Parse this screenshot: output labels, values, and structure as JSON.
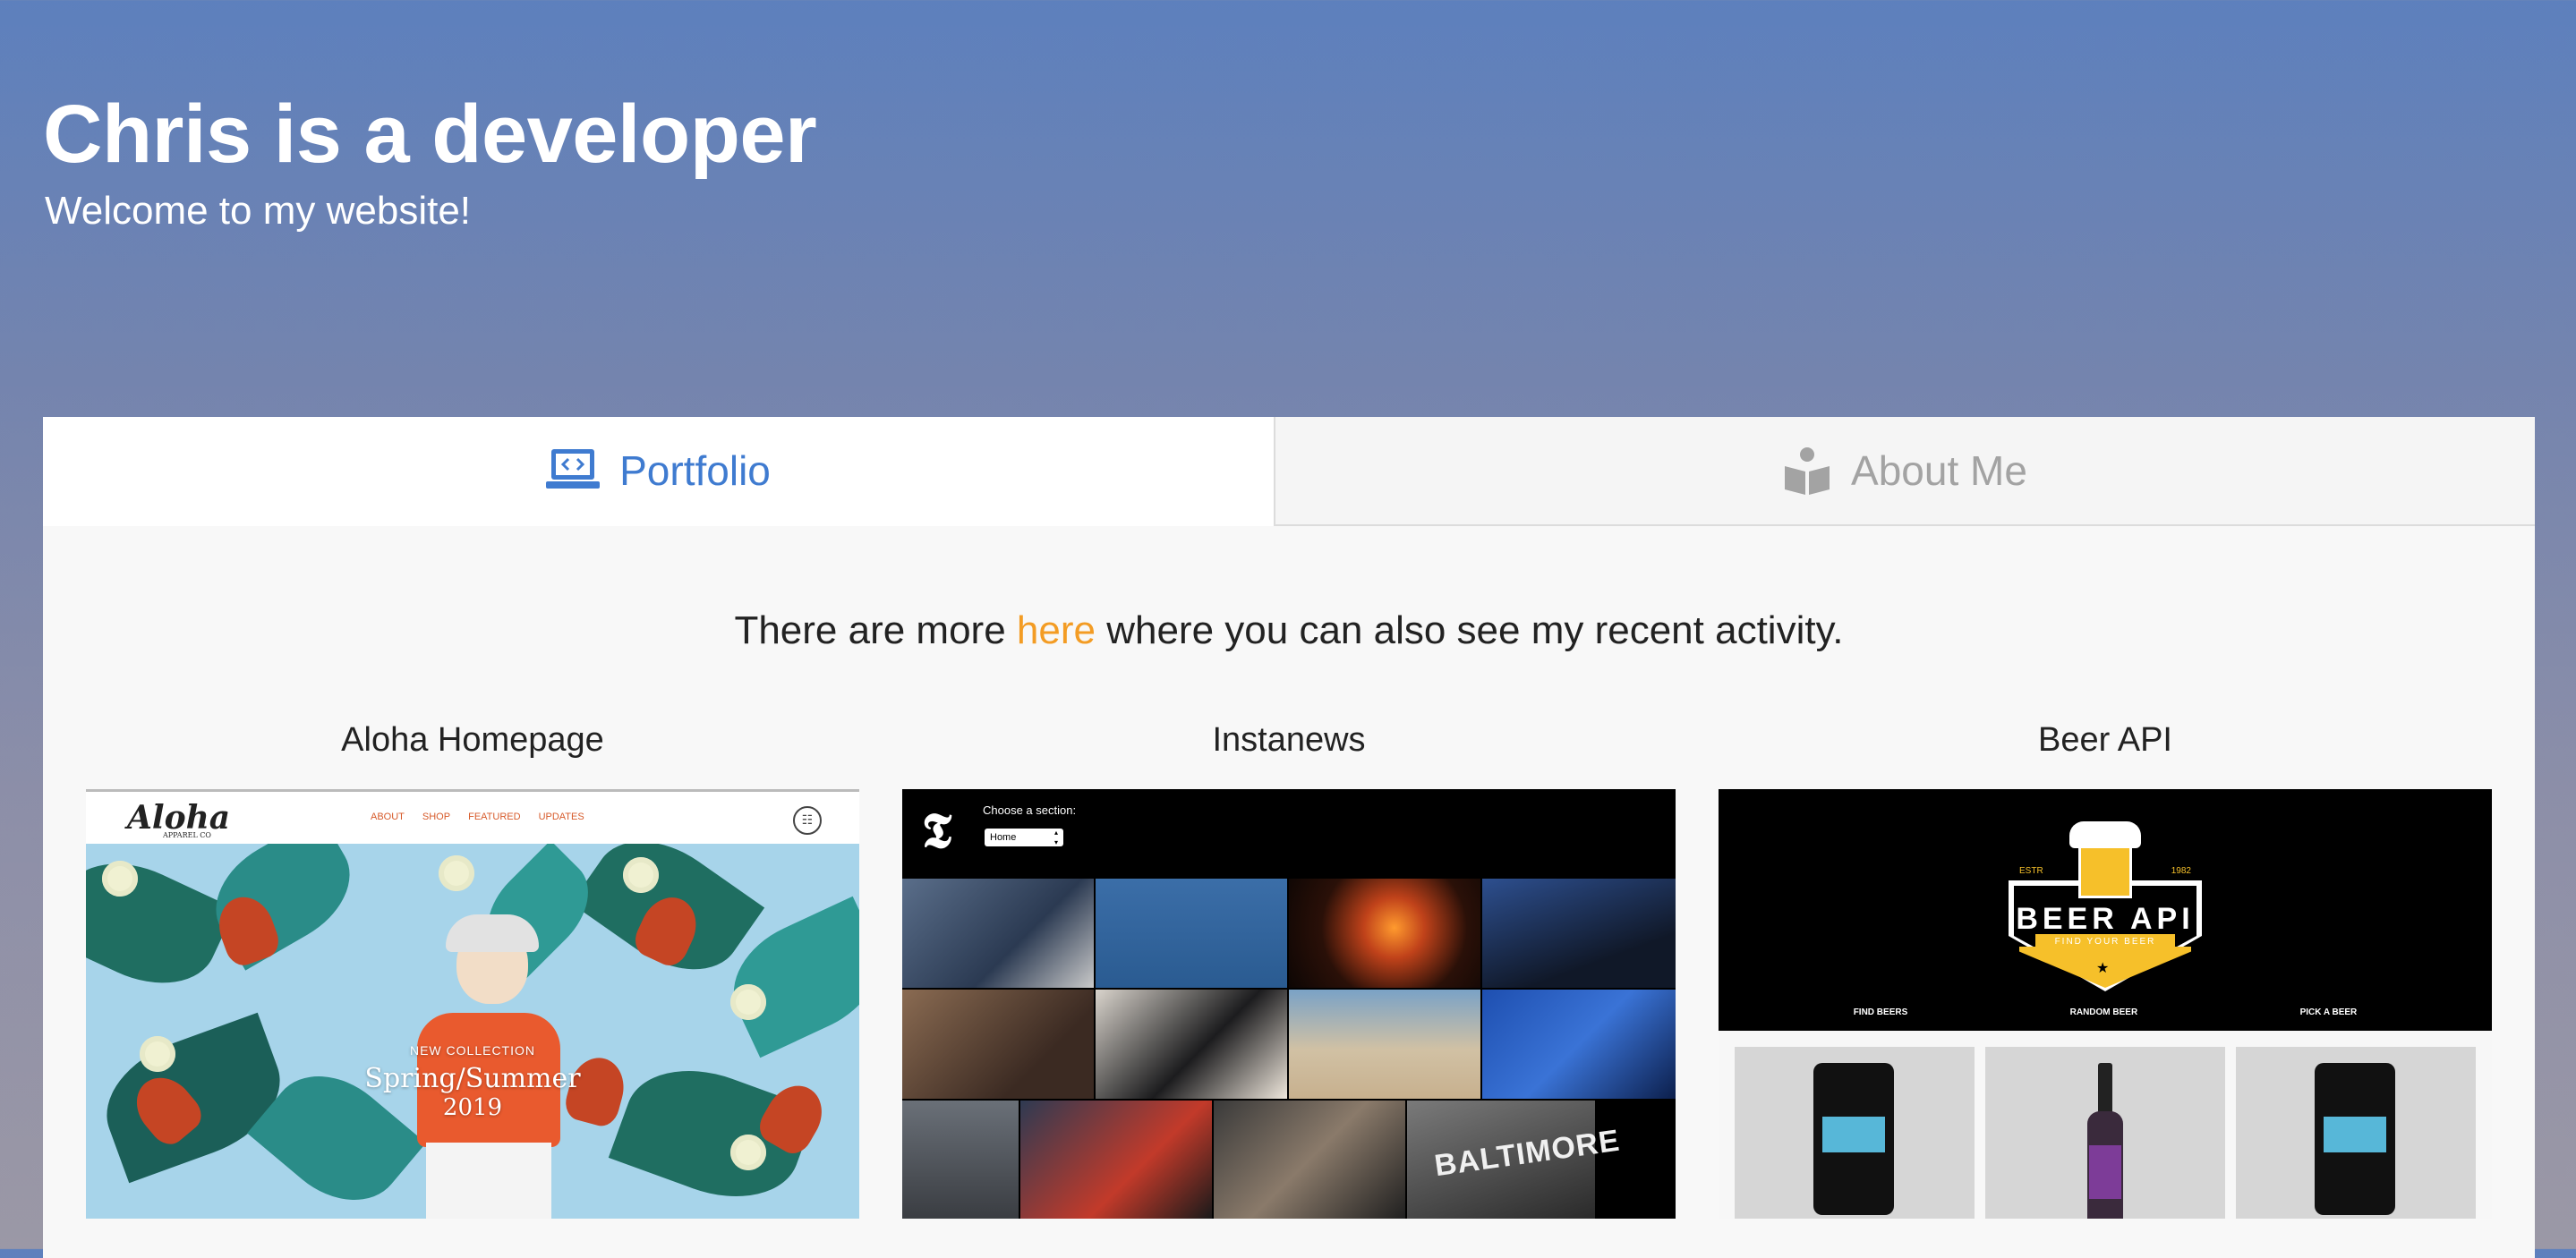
{
  "hero": {
    "title": "Chris is a developer",
    "subtitle": "Welcome to my website!"
  },
  "tabs": [
    {
      "label": "Portfolio",
      "icon": "laptop-code-icon",
      "active": true,
      "color": "#3f7bd0"
    },
    {
      "label": "About Me",
      "icon": "person-reading-icon",
      "active": false,
      "color": "#a3a3a3"
    }
  ],
  "intro": {
    "before": "There are more ",
    "link": "here",
    "after": " where you can also see my recent activity.",
    "link_color": "#f39c24"
  },
  "projects": [
    {
      "title": "Aloha Homepage",
      "screenshot": {
        "logo": "Aloha",
        "logo_sub": "APPAREL CO",
        "nav": [
          "ABOUT",
          "SHOP",
          "FEATURED",
          "UPDATES"
        ],
        "cart_icon": "basket-icon",
        "kicker": "NEW COLLECTION",
        "headline": "Spring/Summer",
        "year": "2019"
      }
    },
    {
      "title": "Instanews",
      "screenshot": {
        "logo_icon": "nyt-t-logo-icon",
        "choose_label": "Choose a section:",
        "select_value": "Home",
        "tile_text": "BALTIMORE"
      }
    },
    {
      "title": "Beer API",
      "screenshot": {
        "estr": "ESTR",
        "year": "1982",
        "logo_title": "BEER API",
        "tagline": "FIND YOUR BEER",
        "nav": [
          "FIND BEERS",
          "RANDOM BEER",
          "PICK A BEER"
        ]
      }
    }
  ]
}
